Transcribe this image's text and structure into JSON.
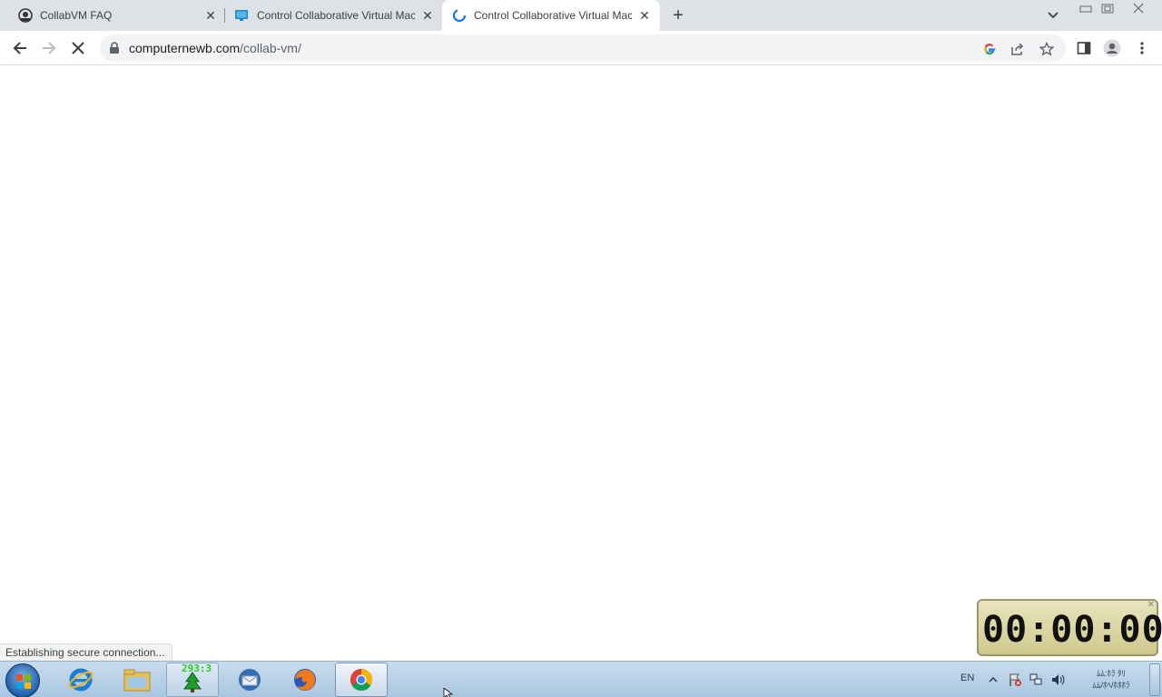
{
  "browser": {
    "tabs": [
      {
        "title": "CollabVM FAQ",
        "icon": "collabvm-icon",
        "active": false
      },
      {
        "title": "Control Collaborative Virtual Mac",
        "icon": "monitor-icon",
        "active": false
      },
      {
        "title": "Control Collaborative Virtual Mac",
        "icon": "loading-icon",
        "active": true
      }
    ],
    "new_tab_label": "+",
    "address": {
      "host": "computernewb.com",
      "path": "/collab-vm/"
    }
  },
  "status_text": "Establishing secure connection...",
  "clock": {
    "display": "00:00:00"
  },
  "taskbar": {
    "apps": [
      "internet-explorer",
      "windows-explorer",
      "counter-gadget",
      "thunderbird",
      "firefox",
      "chrome"
    ],
    "counter_badge": "293:3",
    "language": "EN",
    "time_line1": "ﾑﾑ:ﾎﾗ ﾀﾘ",
    "time_line2": "ﾑﾑ/ﾎﾍ/ﾎﾎﾎﾗ"
  },
  "colors": {
    "tabstrip": "#dee1e6",
    "omnibox": "#f1f3f4",
    "taskbar": "#b9d1e6"
  }
}
